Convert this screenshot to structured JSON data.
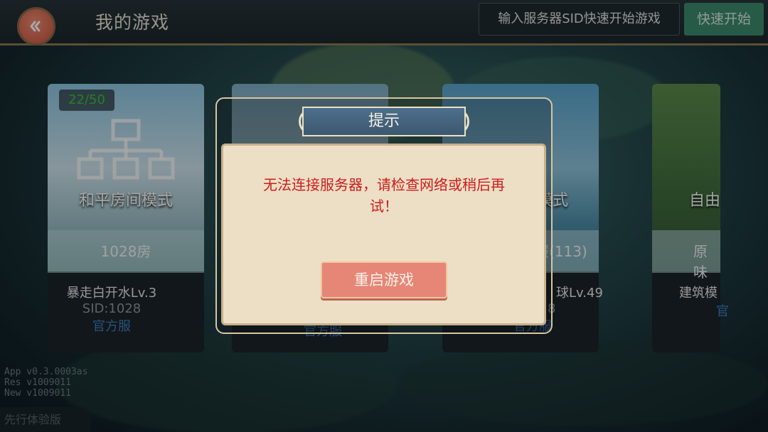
{
  "header": {
    "title": "我的游戏",
    "sid_input": {
      "value": "",
      "placeholder": "输入服务器SID快速开始游戏"
    },
    "quick_start_label": "快速开始"
  },
  "cards": [
    {
      "online": "22/50",
      "mode": "和平房间模式",
      "rooms": "1028房",
      "name": "暴走白开水Lv.3",
      "sid": "SID:1028",
      "tag": "官方服"
    },
    {
      "mode": "",
      "rooms": "",
      "name": "",
      "sid": "",
      "tag": "官方服"
    },
    {
      "mode": "模式",
      "rooms": "服(113)",
      "name": "球Lv.49",
      "sid": "8",
      "tag": "官方服"
    },
    {
      "mode": "自由",
      "rooms": "原味",
      "name": "建筑模",
      "sid": "",
      "tag": "官"
    }
  ],
  "dialog": {
    "title": "提示",
    "message_line1": "无法连接服务器，请检查网络或稍后再",
    "message_line2": "试！",
    "button_label": "重启游戏"
  },
  "version": {
    "app": "App  v0.3.0003as",
    "res": "Res   v1009011",
    "new": "New  v1009011"
  },
  "preview_label": "先行体验版",
  "colors": {
    "accent_red": "#cc1d1d",
    "button": "#e68676",
    "ribbon": "#4e6f8a",
    "quick_start": "#3c8d6e",
    "online_green": "#39c339"
  }
}
